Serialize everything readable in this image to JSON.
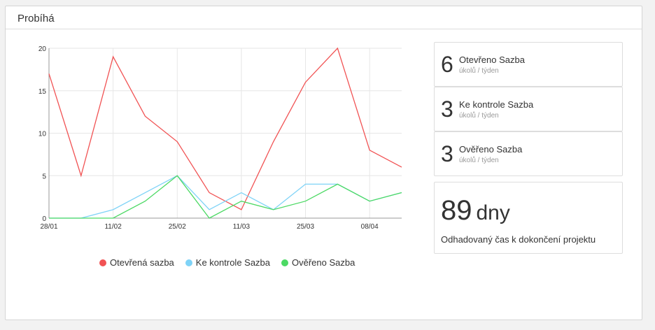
{
  "panel": {
    "title": "Probíhá"
  },
  "chart_data": {
    "type": "line",
    "x": [
      "28/01",
      "04/02",
      "11/02",
      "18/02",
      "25/02",
      "04/03",
      "11/03",
      "18/03",
      "25/03",
      "01/04",
      "08/04",
      "15/04"
    ],
    "tick_labels": [
      "28/01",
      "11/02",
      "25/02",
      "11/03",
      "25/03",
      "08/04"
    ],
    "ylim": [
      0,
      20
    ],
    "yticks": [
      0,
      5,
      10,
      15,
      20
    ],
    "grid": true,
    "legend": "bottom",
    "series": [
      {
        "name": "Otevřená sazba",
        "color": "#f15354",
        "values": [
          17,
          5,
          19,
          12,
          9,
          3,
          1,
          9,
          16,
          20,
          8,
          6
        ]
      },
      {
        "name": "Ke kontrole Sazba",
        "color": "#7fd3f7",
        "values": [
          0,
          0,
          1,
          3,
          5,
          1,
          3,
          1,
          4,
          4,
          2,
          3
        ]
      },
      {
        "name": "Ověřeno Sazba",
        "color": "#4cd964",
        "values": [
          0,
          0,
          0,
          2,
          5,
          0,
          2,
          1,
          2,
          4,
          2,
          3
        ]
      }
    ]
  },
  "stats": [
    {
      "value": "6",
      "label": "Otevřeno Sazba",
      "sub": "úkolů / týden"
    },
    {
      "value": "3",
      "label": "Ke kontrole Sazba",
      "sub": "úkolů / týden"
    },
    {
      "value": "3",
      "label": "Ověřeno Sazba",
      "sub": "úkolů / týden"
    }
  ],
  "estimate": {
    "value": "89",
    "unit": "dny",
    "label": "Odhadovaný čas k dokončení projektu"
  }
}
